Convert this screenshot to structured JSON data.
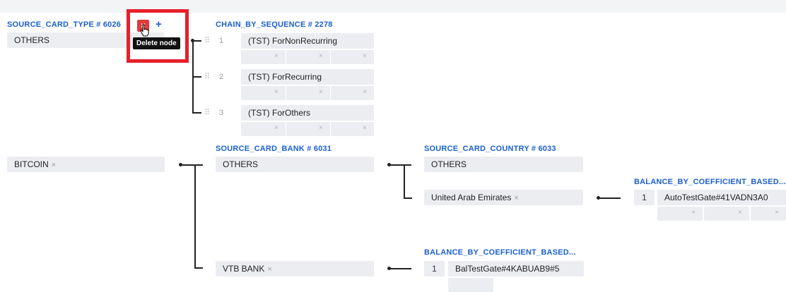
{
  "headers": {
    "source_card_type": "SOURCE_CARD_TYPE # 6026",
    "chain_by_sequence": "CHAIN_BY_SEQUENCE # 2278",
    "source_card_bank": "SOURCE_CARD_BANK # 6031",
    "source_card_country": "SOURCE_CARD_COUNTRY # 6033",
    "balance_coef_right": "BALANCE_BY_COEFFICIENT_BASED...",
    "balance_coef_mid": "BALANCE_BY_COEFFICIENT_BASED..."
  },
  "toolbar": {
    "delete_icon": "×",
    "add_icon": "+",
    "tooltip": "Delete node"
  },
  "values": {
    "others_type": "OTHERS",
    "bitcoin": "BITCOIN",
    "others_bank": "OTHERS",
    "vtb_bank": "VTB BANK",
    "others_country": "OTHERS",
    "uae": "United Arab Emirates"
  },
  "remove_glyph": "×",
  "grip_glyph": "⠿",
  "chain": [
    {
      "index": "1",
      "name": "(TST) ForNonRecurring"
    },
    {
      "index": "2",
      "name": "(TST) ForRecurring"
    },
    {
      "index": "3",
      "name": "(TST) ForOthers"
    }
  ],
  "balance_mid": {
    "index": "1",
    "name": "BalTestGate#4KABUAB9#5"
  },
  "balance_right": {
    "index": "1",
    "name": "AutoTestGate#41VADN3A0"
  }
}
